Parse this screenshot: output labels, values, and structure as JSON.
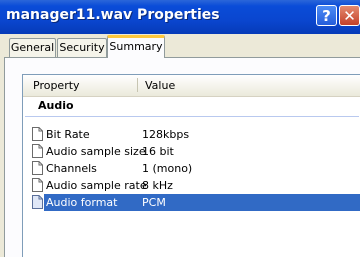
{
  "window": {
    "title": "manager11.wav Properties",
    "help_label": "?",
    "close_label": "✕"
  },
  "tabs": [
    {
      "label": "General"
    },
    {
      "label": "Security"
    },
    {
      "label": "Summary",
      "active": true
    }
  ],
  "list": {
    "columns": [
      "Property",
      "Value"
    ],
    "group": "Audio",
    "rows": [
      {
        "property": "Bit Rate",
        "value": "128kbps"
      },
      {
        "property": "Audio sample size",
        "value": "16 bit"
      },
      {
        "property": "Channels",
        "value": "1 (mono)"
      },
      {
        "property": "Audio sample rate",
        "value": "8 kHz"
      },
      {
        "property": "Audio format",
        "value": "PCM",
        "selected": true
      }
    ]
  },
  "icons": [
    "help-icon",
    "close-icon",
    "document-icon"
  ],
  "colors": {
    "titlebar": "#0a46cf",
    "selection": "#316ac5",
    "active_tab_accent": "#ffc83c"
  }
}
